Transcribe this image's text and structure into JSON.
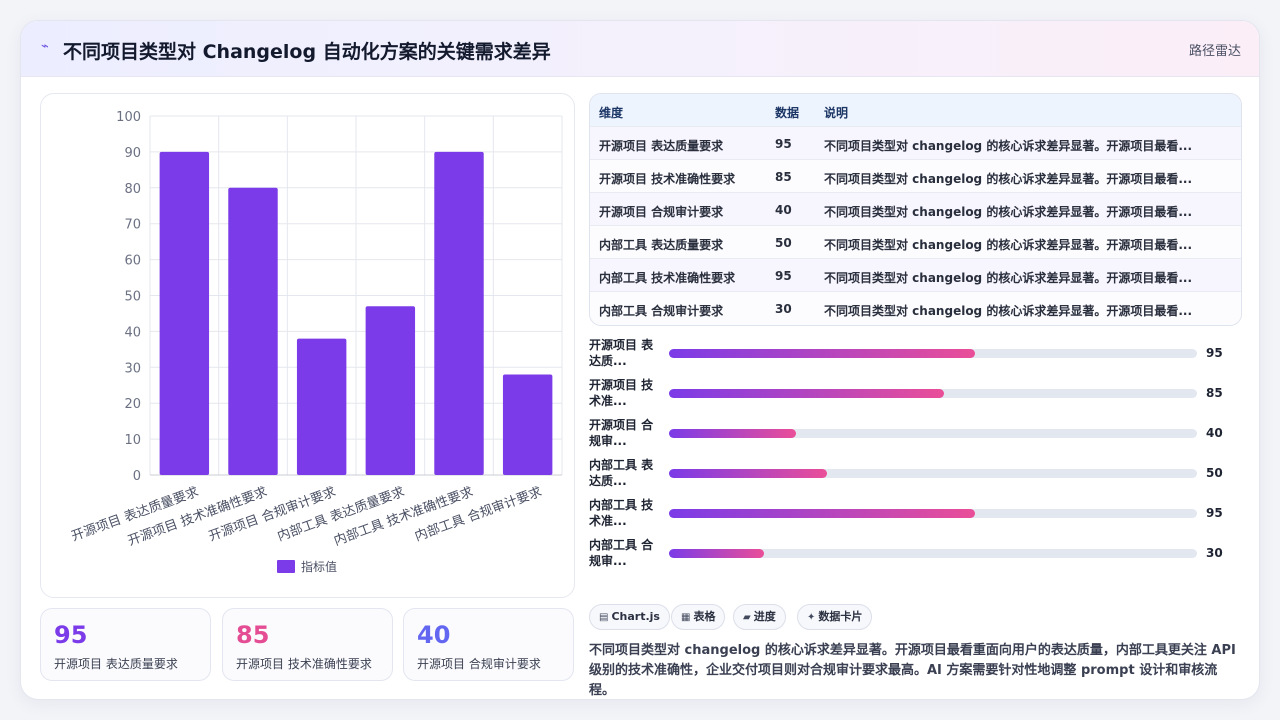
{
  "header": {
    "title": "不同项目类型对 Changelog 自动化方案的关键需求差异",
    "tag": "路径雷达"
  },
  "colors": {
    "bar": "#7b3be8",
    "accent_purple": "#7b3be8",
    "accent_pink": "#e44d93",
    "accent_indigo": "#6366f1"
  },
  "chart_data": {
    "type": "bar",
    "categories": [
      "开源项目 表达质量要求",
      "开源项目 技术准确性要求",
      "开源项目 合规审计要求",
      "内部工具 表达质量要求",
      "内部工具 技术准确性要求",
      "内部工具 合规审计要求"
    ],
    "series": [
      {
        "name": "指标值",
        "values": [
          90,
          80,
          38,
          47,
          90,
          28
        ]
      }
    ],
    "ylim": [
      0,
      100
    ],
    "yticks": [
      0,
      10,
      20,
      30,
      40,
      50,
      60,
      70,
      80,
      90,
      100
    ],
    "grid": true,
    "legend": "bottom"
  },
  "stats": [
    {
      "value": "95",
      "label": "开源项目 表达质量要求"
    },
    {
      "value": "85",
      "label": "开源项目 技术准确性要求"
    },
    {
      "value": "40",
      "label": "开源项目 合规审计要求"
    }
  ],
  "table": {
    "headers": [
      "维度",
      "数据",
      "说明"
    ],
    "rows": [
      [
        "开源项目 表达质量要求",
        "95",
        "不同项目类型对 changelog 的核心诉求差异显著。开源项目最看..."
      ],
      [
        "开源项目 技术准确性要求",
        "85",
        "不同项目类型对 changelog 的核心诉求差异显著。开源项目最看..."
      ],
      [
        "开源项目 合规审计要求",
        "40",
        "不同项目类型对 changelog 的核心诉求差异显著。开源项目最看..."
      ],
      [
        "内部工具 表达质量要求",
        "50",
        "不同项目类型对 changelog 的核心诉求差异显著。开源项目最看..."
      ],
      [
        "内部工具 技术准确性要求",
        "95",
        "不同项目类型对 changelog 的核心诉求差异显著。开源项目最看..."
      ],
      [
        "内部工具 合规审计要求",
        "30",
        "不同项目类型对 changelog 的核心诉求差异显著。开源项目最看..."
      ]
    ]
  },
  "progress": [
    {
      "label": "开源项目 表达质...",
      "value": 95,
      "display": "95",
      "fill_pct": 58
    },
    {
      "label": "开源项目 技术准...",
      "value": 85,
      "display": "85",
      "fill_pct": 52
    },
    {
      "label": "开源项目 合规审...",
      "value": 40,
      "display": "40",
      "fill_pct": 24
    },
    {
      "label": "内部工具 表达质...",
      "value": 50,
      "display": "50",
      "fill_pct": 30
    },
    {
      "label": "内部工具 技术准...",
      "value": 95,
      "display": "95",
      "fill_pct": 58
    },
    {
      "label": "内部工具 合规审...",
      "value": 30,
      "display": "30",
      "fill_pct": 18
    }
  ],
  "chips": [
    {
      "icon": "▤",
      "label": "Chart.js"
    },
    {
      "icon": "▦",
      "label": "表格"
    },
    {
      "icon": "▰",
      "label": "进度"
    },
    {
      "icon": "✦",
      "label": "数据卡片"
    }
  ],
  "summary": "不同项目类型对 changelog 的核心诉求差异显著。开源项目最看重面向用户的表达质量，内部工具更关注 API 级别的技术准确性，企业交付项目则对合规审计要求最高。AI 方案需要针对性地调整 prompt 设计和审核流程。"
}
